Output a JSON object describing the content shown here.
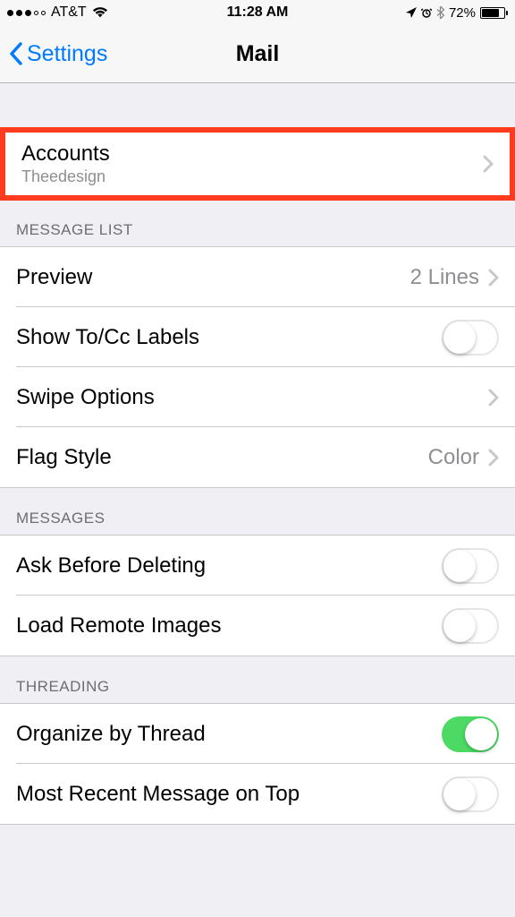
{
  "status_bar": {
    "carrier": "AT&T",
    "time": "11:28 AM",
    "battery_percent": "72%"
  },
  "nav": {
    "back_label": "Settings",
    "title": "Mail"
  },
  "accounts": {
    "label": "Accounts",
    "subtitle": "Theedesign"
  },
  "sections": {
    "message_list": {
      "header": "MESSAGE LIST",
      "preview": {
        "label": "Preview",
        "detail": "2 Lines"
      },
      "show_tocc": {
        "label": "Show To/Cc Labels"
      },
      "swipe": {
        "label": "Swipe Options"
      },
      "flag": {
        "label": "Flag Style",
        "detail": "Color"
      }
    },
    "messages": {
      "header": "MESSAGES",
      "ask_delete": {
        "label": "Ask Before Deleting"
      },
      "load_remote": {
        "label": "Load Remote Images"
      }
    },
    "threading": {
      "header": "THREADING",
      "organize": {
        "label": "Organize by Thread"
      },
      "most_recent": {
        "label": "Most Recent Message on Top"
      }
    }
  }
}
